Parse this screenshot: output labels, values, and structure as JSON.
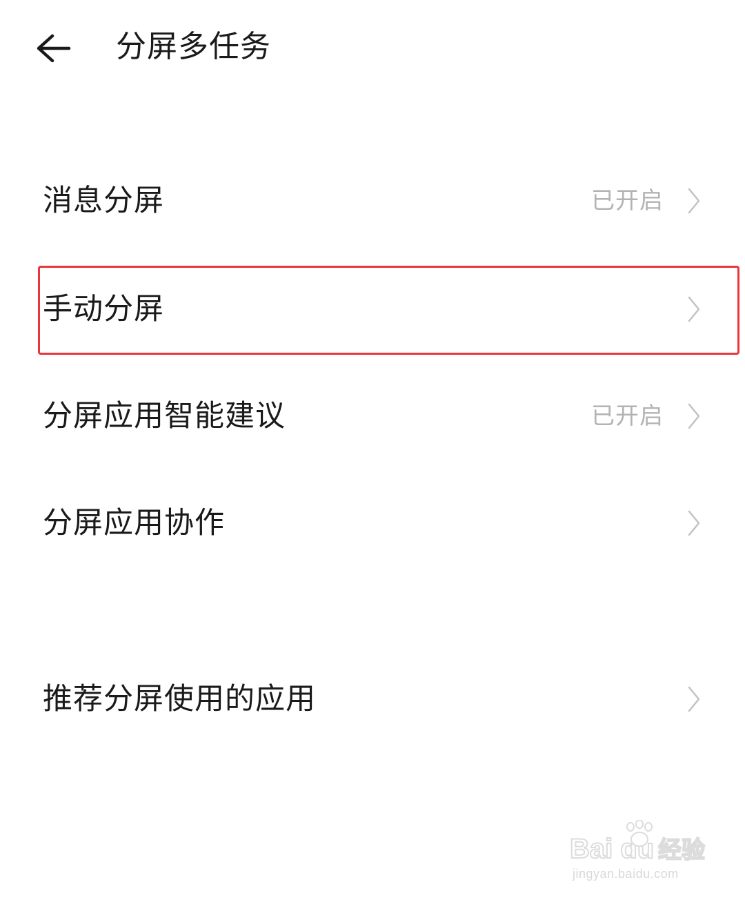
{
  "header": {
    "title": "分屏多任务",
    "back_icon": "arrow-left-icon"
  },
  "settings": [
    {
      "label": "消息分屏",
      "status": "已开启",
      "icon": "chevron-right-icon"
    },
    {
      "label": "手动分屏",
      "status": "",
      "icon": "chevron-right-icon",
      "highlighted": true
    },
    {
      "label": "分屏应用智能建议",
      "status": "已开启",
      "icon": "chevron-right-icon"
    },
    {
      "label": "分屏应用协作",
      "status": "",
      "icon": "chevron-right-icon"
    },
    {
      "label": "推荐分屏使用的应用",
      "status": "",
      "icon": "chevron-right-icon"
    }
  ],
  "watermark": {
    "brand": "Bai du",
    "product": "经验",
    "url": "jingyan.baidu.com"
  },
  "colors": {
    "text": "#1a1a1a",
    "status": "#b3b3b3",
    "chevron": "#c2c2c2",
    "highlight": "#e8363a",
    "background": "#ffffff"
  }
}
